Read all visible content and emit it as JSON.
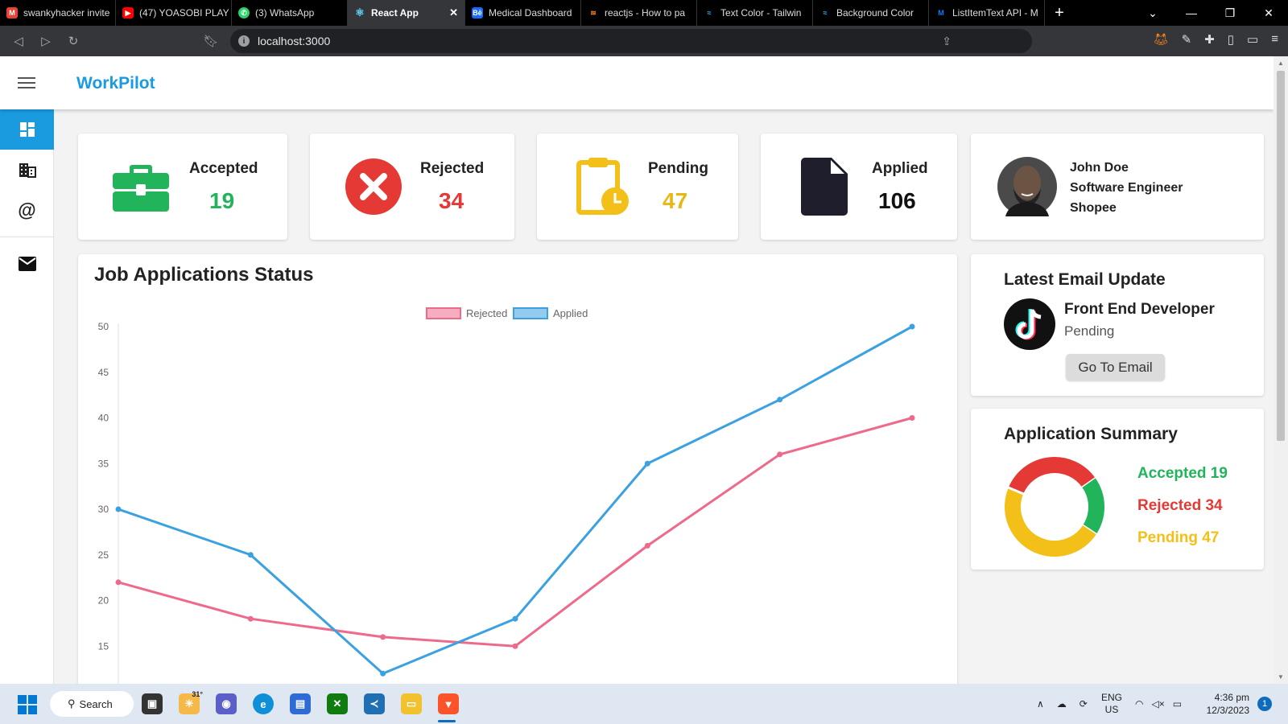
{
  "browser": {
    "tabs": [
      {
        "label": "swankyhacker invite",
        "icon": "gmail-icon",
        "color": "#ea4335"
      },
      {
        "label": "(47) YOASOBI PLAY",
        "icon": "youtube-icon",
        "color": "#ff0000"
      },
      {
        "label": "(3) WhatsApp",
        "icon": "whatsapp-icon",
        "color": "#25d366"
      },
      {
        "label": "React App",
        "icon": "react-icon",
        "color": "#61dafb",
        "active": true
      },
      {
        "label": "Medical Dashboard",
        "icon": "behance-icon",
        "color": "#1769ff"
      },
      {
        "label": "reactjs - How to pa",
        "icon": "stackoverflow-icon",
        "color": "#f48024"
      },
      {
        "label": "Text Color - Tailwin",
        "icon": "tailwind-icon",
        "color": "#38bdf8"
      },
      {
        "label": "Background Color",
        "icon": "tailwind-icon",
        "color": "#38bdf8"
      },
      {
        "label": "ListItemText API - M",
        "icon": "mui-icon",
        "color": "#007fff"
      }
    ],
    "url": "localhost:3000"
  },
  "app": {
    "brand": "WorkPilot",
    "colors": {
      "accent": "#1a9be0",
      "accepted": "#22b45a",
      "rejected": "#e53935",
      "pending": "#f2c018",
      "applied": "#1e1e2d"
    },
    "stats": [
      {
        "label": "Accepted",
        "value": "19",
        "icon": "briefcase-icon"
      },
      {
        "label": "Rejected",
        "value": "34",
        "icon": "x-circle-icon"
      },
      {
        "label": "Pending",
        "value": "47",
        "icon": "clipboard-clock-icon"
      },
      {
        "label": "Applied",
        "value": "106",
        "icon": "file-icon"
      }
    ],
    "profile": {
      "name": "John Doe",
      "role": "Software Engineer",
      "company": "Shopee"
    },
    "latest_email": {
      "title": "Latest Email Update",
      "job": "Front End Developer",
      "status": "Pending",
      "button": "Go To Email",
      "icon": "tiktok-icon"
    },
    "summary": {
      "title": "Application Summary",
      "items": [
        {
          "label": "Accepted 19",
          "value": 19
        },
        {
          "label": "Rejected 34",
          "value": 34
        },
        {
          "label": "Pending 47",
          "value": 47
        }
      ]
    }
  },
  "chart_data": {
    "type": "line",
    "title": "Job Applications Status",
    "ylim": [
      12,
      50
    ],
    "yticks": [
      50,
      45,
      40,
      35,
      30,
      25,
      20,
      15
    ],
    "series": [
      {
        "name": "Rejected",
        "color": "#ee6a8b",
        "values": [
          22,
          18,
          16,
          15,
          26,
          36,
          40
        ]
      },
      {
        "name": "Applied",
        "color": "#3ba1e0",
        "values": [
          30,
          25,
          12,
          18,
          35,
          42,
          50
        ]
      }
    ],
    "legend": "top-center",
    "grid": false
  },
  "taskbar": {
    "search": "Search",
    "weather": "31°",
    "lang1": "ENG",
    "lang2": "US",
    "time": "4:36 pm",
    "date": "12/3/2023",
    "notif": "1"
  }
}
